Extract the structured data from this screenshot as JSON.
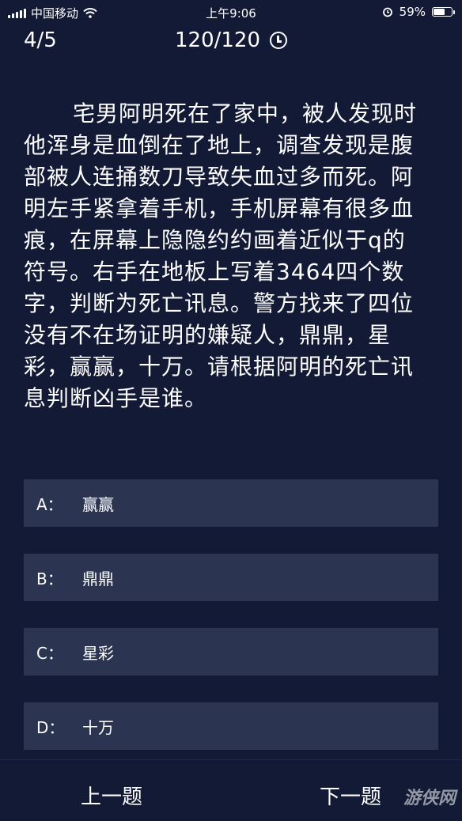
{
  "status_bar": {
    "carrier": "中国移动",
    "time": "上午9:06",
    "battery": "59%",
    "battery_level": 0.59
  },
  "header": {
    "progress": "4/5",
    "timer": "120/120"
  },
  "question": {
    "text": "宅男阿明死在了家中，被人发现时他浑身是血倒在了地上，调查发现是腹部被人连捅数刀导致失血过多而死。阿明左手紧拿着手机，手机屏幕有很多血痕，在屏幕上隐隐约约画着近似于q的符号。右手在地板上写着3464四个数字，判断为死亡讯息。警方找来了四位没有不在场证明的嫌疑人，鼎鼎，星彩，赢赢，十万。请根据阿明的死亡讯息判断凶手是谁。"
  },
  "options": [
    {
      "letter": "A：",
      "text": "赢赢"
    },
    {
      "letter": "B：",
      "text": "鼎鼎"
    },
    {
      "letter": "C：",
      "text": "星彩"
    },
    {
      "letter": "D：",
      "text": "十万"
    }
  ],
  "nav": {
    "prev_label": "上一题",
    "next_label": "下一题"
  },
  "watermark": "游侠网",
  "colors": {
    "background": "#131a36",
    "option_bg": "#2b3552",
    "text": "#ffffff"
  }
}
